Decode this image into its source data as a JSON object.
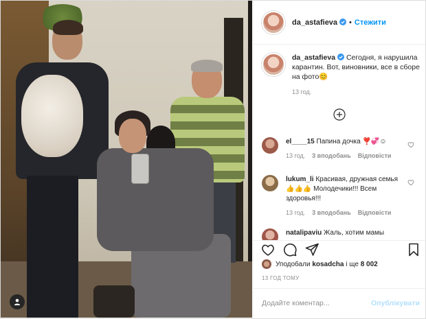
{
  "post_author": {
    "username": "da_astafieva",
    "follow_label": "Стежити",
    "separator": "•"
  },
  "caption": {
    "username": "da_astafieva",
    "text": "Сегодня, я нарушила карантин. Вот, виновники, все в сборе на фото",
    "emoji": "😊",
    "time": "13 год."
  },
  "comments": [
    {
      "username": "el____15",
      "text": "Папина дочка",
      "emoji": "❣️💞☺",
      "time": "13 год.",
      "likes": "3 вподобань",
      "reply": "Відповісти"
    },
    {
      "username": "lukum_li",
      "text": "Красивая, дружная семья 👍👍👍 Молодечики!!! Всем здоровья!!!",
      "time": "13 год.",
      "likes": "3 вподобань",
      "reply": "Відповісти"
    },
    {
      "username": "natalipaviu",
      "text": "Жаль, хотим мамы",
      "time": "",
      "likes": "",
      "reply": ""
    }
  ],
  "likes_line": {
    "prefix": "Уподобали",
    "user": "kosadcha",
    "connector": "і ще",
    "count": "8 002"
  },
  "post_time": "13 ГОД ТОМУ",
  "add_comment": {
    "placeholder": "Додайте коментар...",
    "publish_label": "Опублікувати"
  },
  "colors": {
    "link_blue": "#0095f6",
    "publish_disabled": "#b2dffc",
    "muted": "#8e8e8e",
    "text": "#262626",
    "verified": "#3897f0"
  },
  "icons": [
    "user-tag-icon",
    "verified-badge-icon",
    "load-more-icon",
    "heart-icon",
    "comment-icon",
    "share-icon",
    "bookmark-icon"
  ]
}
